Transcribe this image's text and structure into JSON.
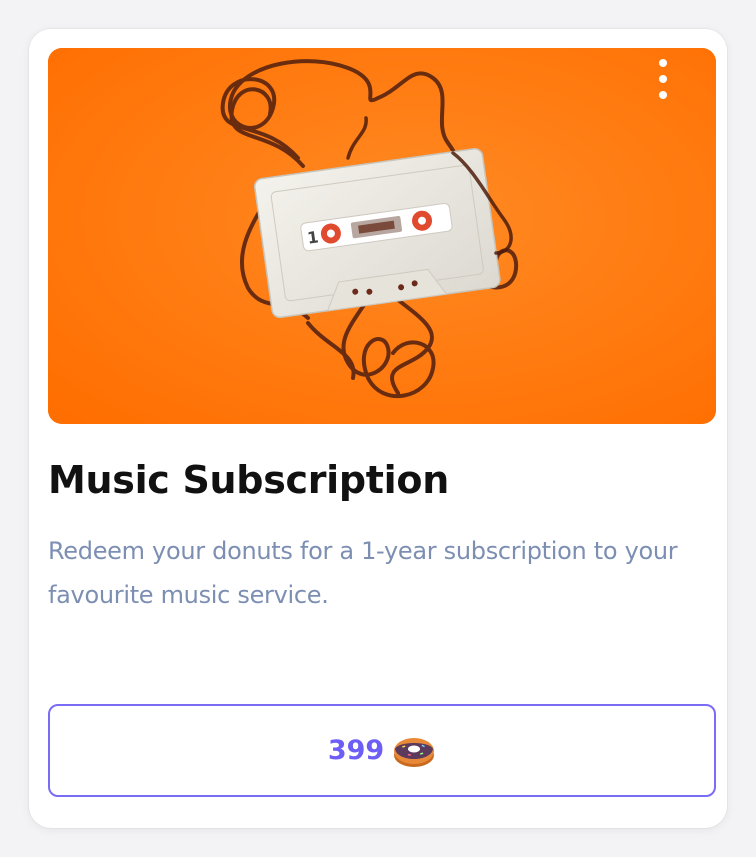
{
  "card": {
    "image_alt": "Cassette tape with unspooled tape on orange background",
    "menu_icon": "more-vertical-icon",
    "title": "Music Subscription",
    "description": "Redeem your donuts for a 1-year subscription to your favourite music service.",
    "price": "399",
    "currency_icon": "donut-icon"
  },
  "colors": {
    "hero_background": "#ff7a14",
    "title": "#111111",
    "description": "#7c8fb3",
    "button_border": "#7b6cf6",
    "price": "#6d5ff5"
  }
}
